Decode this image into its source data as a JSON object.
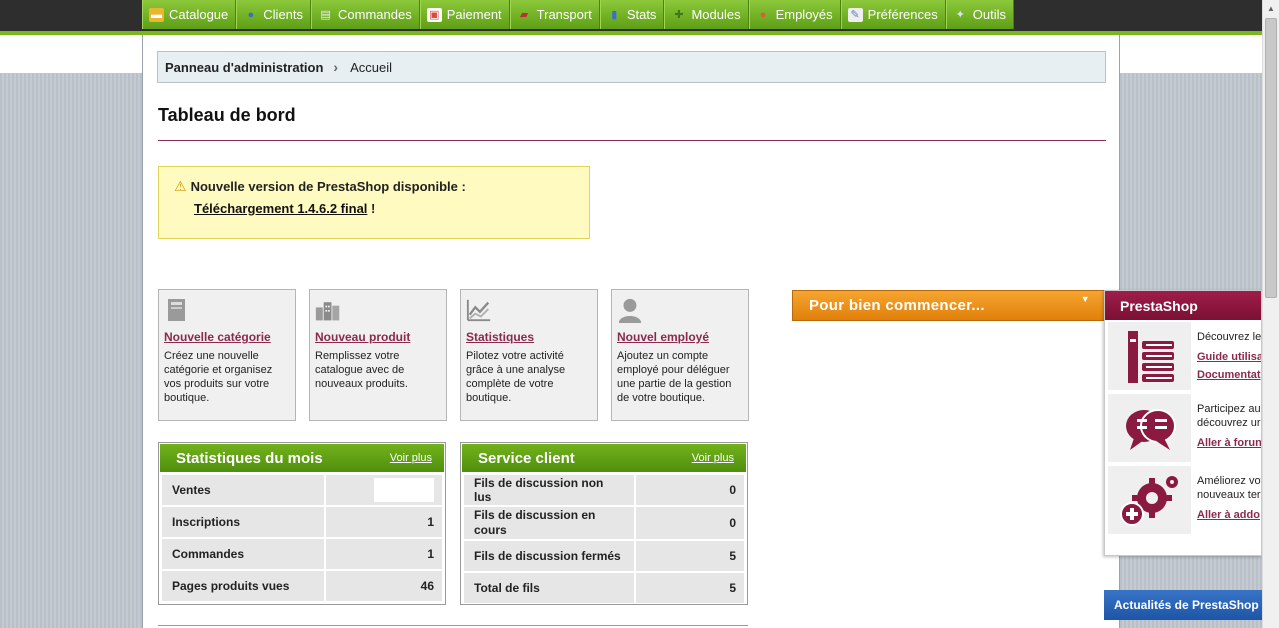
{
  "nav": [
    {
      "label": "Catalogue",
      "icon": "folder-icon",
      "color": "#e9b630"
    },
    {
      "label": "Clients",
      "icon": "user-icon",
      "color": "#3b6fb8"
    },
    {
      "label": "Commandes",
      "icon": "cart-icon",
      "color": "#dddddd"
    },
    {
      "label": "Paiement",
      "icon": "payment-icon",
      "color": "#d94a3b"
    },
    {
      "label": "Transport",
      "icon": "truck-icon",
      "color": "#c03030"
    },
    {
      "label": "Stats",
      "icon": "bar-chart-icon",
      "color": "#3a6ed0"
    },
    {
      "label": "Modules",
      "icon": "puzzle-icon",
      "color": "#66a832"
    },
    {
      "label": "Employés",
      "icon": "employee-icon",
      "color": "#e05a3a"
    },
    {
      "label": "Préférences",
      "icon": "preferences-icon",
      "color": "#eeeeee"
    },
    {
      "label": "Outils",
      "icon": "wrench-icon",
      "color": "#9fb7d8"
    }
  ],
  "breadcrumb": {
    "root": "Panneau d'administration",
    "current": "Accueil"
  },
  "page_title": "Tableau de bord",
  "alert": {
    "text": "Nouvelle version de PrestaShop disponible :",
    "link": "Téléchargement 1.4.6.2 final",
    "suffix": "!"
  },
  "quick_actions": [
    {
      "title": "Nouvelle catégorie",
      "desc": "Créez une nouvelle catégorie et organisez vos produits sur votre boutique.",
      "icon": "category-icon"
    },
    {
      "title": "Nouveau produit",
      "desc": "Remplissez votre catalogue avec de nouveaux produits.",
      "icon": "product-icon"
    },
    {
      "title": "Statistiques",
      "desc": "Pilotez votre activité grâce à une analyse complète de votre boutique.",
      "icon": "stats-icon"
    },
    {
      "title": "Nouvel employé",
      "desc": "Ajoutez un compte employé pour déléguer une partie de la gestion de votre boutique.",
      "icon": "employee-icon"
    }
  ],
  "stats_month": {
    "title": "Statistiques du mois",
    "more": "Voir plus",
    "rows": [
      {
        "label": "Ventes",
        "value": ""
      },
      {
        "label": "Inscriptions",
        "value": "1"
      },
      {
        "label": "Commandes",
        "value": "1"
      },
      {
        "label": "Pages produits vues",
        "value": "46"
      }
    ]
  },
  "customer_service": {
    "title": "Service client",
    "more": "Voir plus",
    "rows": [
      {
        "label": "Fils de discussion non lus",
        "value": "0"
      },
      {
        "label": "Fils de discussion en cours",
        "value": "0"
      },
      {
        "label": "Fils de discussion fermés",
        "value": "5"
      },
      {
        "label": "Total de fils",
        "value": "5"
      }
    ]
  },
  "getting_started": {
    "label": "Pour bien commencer..."
  },
  "prestashop_panel": {
    "title": "PrestaShop",
    "items": [
      {
        "line1": "Découvrez le",
        "link1": "Guide utilisa",
        "link2": "Documentat",
        "icon": "books-icon"
      },
      {
        "line1": "Participez au",
        "line2": "découvrez ur",
        "link1": "Aller à forun",
        "icon": "chat-bubbles-icon"
      },
      {
        "line1": "Améliorez vot",
        "line2": "nouveaux ter",
        "link1": "Aller à addo",
        "icon": "addons-gears-icon"
      }
    ]
  },
  "news": {
    "label": "Actualités de PrestaShop"
  },
  "colors": {
    "nav_green": "#6aa91a",
    "accent_maroon": "#8a2a4c",
    "orange": "#f0931d",
    "alert_bg": "#fffbc0"
  }
}
